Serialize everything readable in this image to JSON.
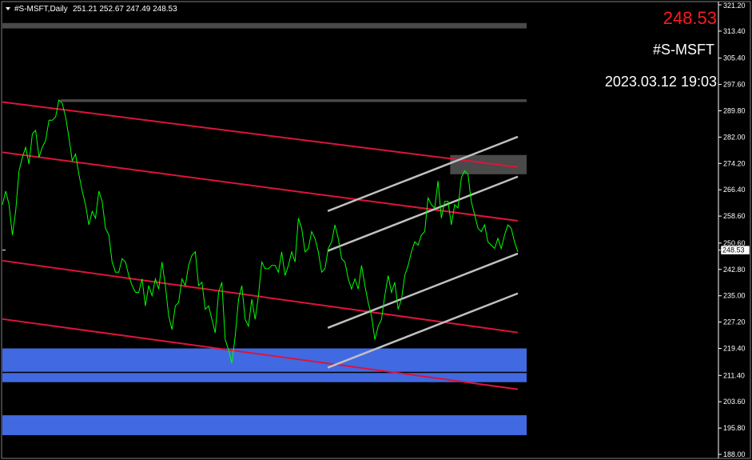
{
  "header": {
    "symbol_tf": "#S-MSFT,Daily",
    "ohlc": "251.21 252.67 247.49 248.53"
  },
  "overlay": {
    "price": "248.53",
    "symbol": "#S-MSFT",
    "datetime": "2023.03.12 19:03"
  },
  "colors": {
    "background": "#000000",
    "price_line": "#00ff00",
    "red_channel": "#dc143c",
    "grey_channel": "#c0c0c0",
    "resistance_zone": "#4a4a4a",
    "support_zone": "#4169e1",
    "current_price_text": "#ff1a1a"
  },
  "icons": {
    "menu": "triangle-down-icon"
  },
  "chart_data": {
    "type": "line",
    "ylim": [
      188.0,
      321.2
    ],
    "xlim": [
      0,
      160
    ],
    "yticks": [
      "321.20",
      "313.40",
      "305.40",
      "297.60",
      "289.80",
      "282.00",
      "274.20",
      "266.40",
      "258.60",
      "250.60",
      "242.80",
      "235.00",
      "227.20",
      "219.40",
      "211.40",
      "203.60",
      "195.80",
      "188.00"
    ],
    "current_price": "248.53",
    "series": [
      {
        "values": [
          262,
          266,
          262,
          253,
          260,
          272,
          276,
          279,
          274,
          283,
          284,
          276,
          279,
          281,
          287,
          287,
          288,
          293,
          292,
          288,
          282,
          275,
          277,
          271,
          266,
          262,
          256,
          260,
          258,
          266,
          263,
          255,
          253,
          245,
          242,
          242,
          246,
          245,
          241,
          238,
          236,
          236,
          240,
          232,
          238,
          235,
          240,
          237,
          245,
          238,
          229,
          225,
          232,
          233,
          240,
          238,
          244,
          247,
          248,
          238,
          239,
          231,
          232,
          228,
          224,
          236,
          239,
          222,
          219,
          215,
          223,
          234,
          238,
          228,
          226,
          234,
          228,
          235,
          245,
          243,
          243,
          244,
          244,
          242,
          248,
          241,
          244,
          248,
          245,
          258,
          255,
          248,
          249,
          254,
          252,
          248,
          242,
          243,
          249,
          251,
          256,
          252,
          246,
          245,
          240,
          237,
          240,
          237,
          244,
          238,
          233,
          229,
          222,
          226,
          228,
          235,
          241,
          236,
          239,
          231,
          234,
          241,
          244,
          248,
          251,
          250,
          253,
          254,
          264,
          262,
          261,
          269,
          258,
          263,
          263,
          256,
          262,
          261,
          270,
          272,
          271,
          263,
          259,
          255,
          254,
          256,
          251,
          250,
          249,
          252,
          249,
          253,
          256,
          255,
          251,
          248
        ]
      }
    ],
    "channels_red": [
      {
        "x0": 0,
        "y0": 292.4,
        "x1": 160,
        "y1": 273.1
      },
      {
        "x0": 0,
        "y0": 277.5,
        "x1": 160,
        "y1": 257.2
      },
      {
        "x0": 0,
        "y0": 245.4,
        "x1": 160,
        "y1": 224.1
      },
      {
        "x0": 0,
        "y0": 228.1,
        "x1": 160,
        "y1": 207.3
      }
    ],
    "channels_grey": [
      {
        "x0": 101,
        "y0": 260.1,
        "x1": 160,
        "y1": 282.1
      },
      {
        "x0": 101,
        "y0": 248.3,
        "x1": 160,
        "y1": 270.3
      },
      {
        "x0": 101,
        "y0": 225.5,
        "x1": 160,
        "y1": 247.5
      },
      {
        "x0": 101,
        "y0": 213.7,
        "x1": 160,
        "y1": 235.7
      }
    ],
    "zones": [
      {
        "kind": "resistance",
        "y_low": 314.2,
        "y_high": 315.8,
        "x_start": 0
      },
      {
        "kind": "resistance",
        "y_low": 292.4,
        "y_high": 293.2,
        "x_start": 18
      },
      {
        "kind": "resistance",
        "y_low": 271.0,
        "y_high": 276.7,
        "x_start": 139
      },
      {
        "kind": "support",
        "y_low": 209.4,
        "y_high": 219.4,
        "x_start": 0
      },
      {
        "kind": "support",
        "y_low": 193.7,
        "y_high": 199.6,
        "x_start": 0
      }
    ],
    "hline": 212.3,
    "grid": false
  }
}
